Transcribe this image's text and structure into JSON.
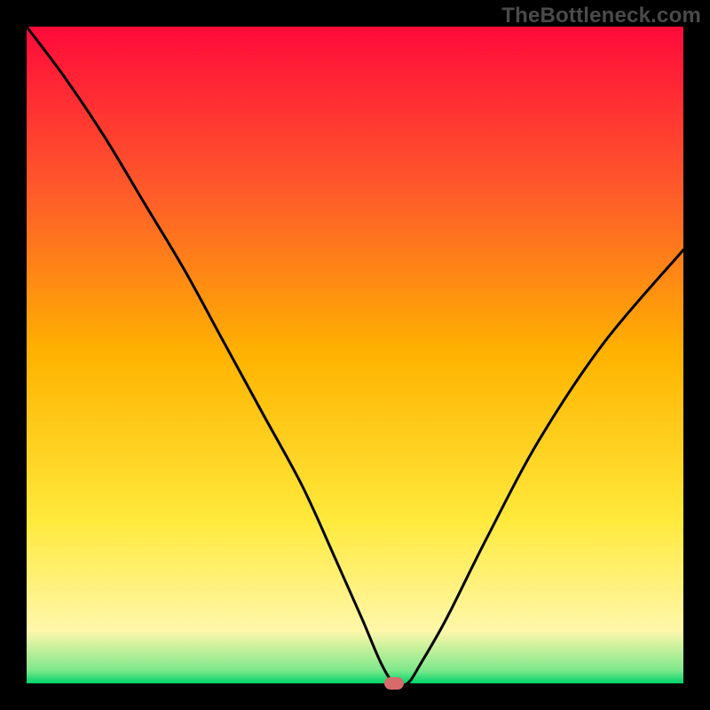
{
  "watermark": "TheBottleneck.com",
  "chart_data": {
    "type": "line",
    "title": "",
    "xlabel": "",
    "ylabel": "",
    "xlim": [
      0,
      100
    ],
    "ylim": [
      0,
      100
    ],
    "grid": false,
    "legend": false,
    "background_gradient": {
      "stops": [
        {
          "pos": 0.0,
          "color": "#ff0a3a"
        },
        {
          "pos": 0.25,
          "color": "#ff5a2a"
        },
        {
          "pos": 0.5,
          "color": "#ffb300"
        },
        {
          "pos": 0.75,
          "color": "#ffe93b"
        },
        {
          "pos": 0.92,
          "color": "#fff7aa"
        },
        {
          "pos": 0.98,
          "color": "#7de88a"
        },
        {
          "pos": 1.0,
          "color": "#00d46a"
        }
      ]
    },
    "optimum_marker": {
      "x": 56,
      "y": 0,
      "color": "#d76b6b"
    },
    "series": [
      {
        "name": "bottleneck-curve",
        "color": "#000000",
        "x": [
          0,
          6,
          12,
          18,
          24,
          30,
          36,
          42,
          47,
          51,
          54,
          56,
          58,
          60,
          64,
          70,
          78,
          88,
          100
        ],
        "y": [
          100,
          92,
          83,
          73,
          63,
          52,
          41,
          30,
          19,
          10,
          3,
          0,
          0,
          3,
          10,
          22,
          37,
          52,
          66
        ]
      }
    ]
  }
}
